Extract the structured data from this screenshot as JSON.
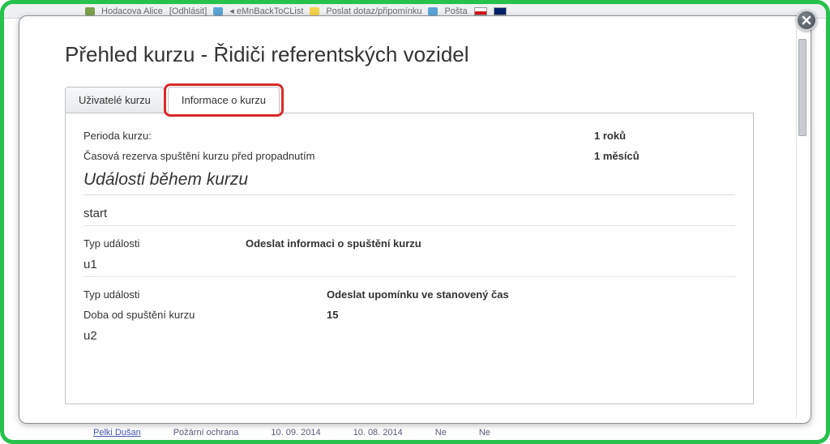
{
  "bg": {
    "top": {
      "items": [
        "Hodacova Alice",
        "[Odhlásit]",
        "◂ eMnBackToCList",
        "Poslat dotaz/připomínku",
        "Pošta"
      ]
    },
    "bottom": {
      "name": "Pelki Dušan",
      "course": "Požární ochrana",
      "date1": "10. 09. 2014",
      "date2": "10. 08. 2014",
      "col5": "Ne",
      "col6": "Ne"
    }
  },
  "modal": {
    "title": "Přehled kurzu - Řidiči referentských vozidel",
    "tabs": [
      {
        "id": "users",
        "label": "Uživatelé kurzu",
        "active": false
      },
      {
        "id": "info",
        "label": "Informace o kurzu",
        "active": true,
        "highlight": true
      }
    ],
    "info": {
      "period_label": "Perioda kurzu:",
      "period_value": "1 roků",
      "reserve_label": "Časová rezerva spuštění kurzu před propadnutím",
      "reserve_value": "1 měsíců",
      "events_heading": "Události během kurzu",
      "events": [
        {
          "name": "start",
          "rows": [
            {
              "k": "Typ události",
              "v": "Odeslat informaci o spuštění kurzu"
            }
          ]
        },
        {
          "name": "u1",
          "rows": [
            {
              "k": "Typ události",
              "v": "Odeslat upomínku ve stanovený čas"
            },
            {
              "k": "Doba od spuštění kurzu",
              "v": "15"
            }
          ]
        },
        {
          "name": "u2",
          "rows": []
        }
      ]
    }
  }
}
